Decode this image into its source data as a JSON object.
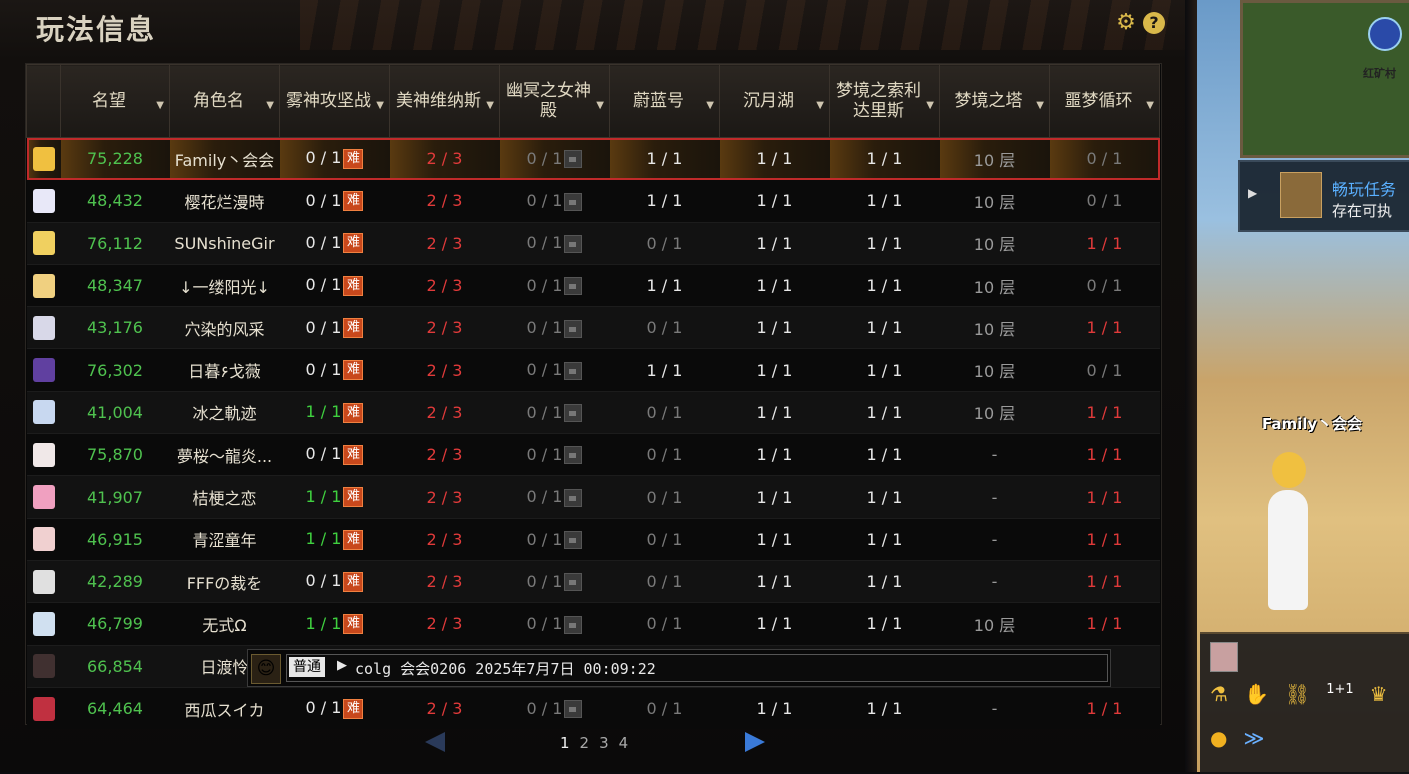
{
  "panel": {
    "title": "玩法信息"
  },
  "columns": [
    {
      "label": ""
    },
    {
      "label": "名望"
    },
    {
      "label": "角色名"
    },
    {
      "label": "雾神攻坚战"
    },
    {
      "label": "美神维纳斯"
    },
    {
      "label": "幽冥之女神殿"
    },
    {
      "label": "蔚蓝号"
    },
    {
      "label": "沉月湖"
    },
    {
      "label": "梦境之索利达里斯"
    },
    {
      "label": "梦境之塔"
    },
    {
      "label": "噩梦循环"
    }
  ],
  "rows": [
    {
      "fame": "75,228",
      "name": "Family丶会会",
      "c1": "0 / 1",
      "c1tag": "hard",
      "c2": "2 / 3",
      "c3": "0 / 1",
      "c4": "1 / 1",
      "c5": "1 / 1",
      "c6": "1 / 1",
      "c7": "10 层",
      "c8": "0 / 1"
    },
    {
      "fame": "48,432",
      "name": "樱花烂漫時",
      "c1": "0 / 1",
      "c1tag": "hard",
      "c2": "2 / 3",
      "c3": "0 / 1",
      "c4": "1 / 1",
      "c5": "1 / 1",
      "c6": "1 / 1",
      "c7": "10 层",
      "c8": "0 / 1"
    },
    {
      "fame": "76,112",
      "name": "SUNshīneGir",
      "c1": "0 / 1",
      "c1tag": "hard",
      "c2": "2 / 3",
      "c3": "0 / 1",
      "c4": "0 / 1",
      "c5": "1 / 1",
      "c6": "1 / 1",
      "c7": "10 层",
      "c8": "1 / 1"
    },
    {
      "fame": "48,347",
      "name": "↓一缕阳光↓",
      "c1": "0 / 1",
      "c1tag": "hard",
      "c2": "2 / 3",
      "c3": "0 / 1",
      "c4": "1 / 1",
      "c5": "1 / 1",
      "c6": "1 / 1",
      "c7": "10 层",
      "c8": "0 / 1"
    },
    {
      "fame": "43,176",
      "name": "穴染的风采",
      "c1": "0 / 1",
      "c1tag": "hard",
      "c2": "2 / 3",
      "c3": "0 / 1",
      "c4": "0 / 1",
      "c5": "1 / 1",
      "c6": "1 / 1",
      "c7": "10 层",
      "c8": "1 / 1"
    },
    {
      "fame": "76,302",
      "name": "日暮۶戈薇",
      "c1": "0 / 1",
      "c1tag": "hard",
      "c2": "2 / 3",
      "c3": "0 / 1",
      "c4": "1 / 1",
      "c5": "1 / 1",
      "c6": "1 / 1",
      "c7": "10 层",
      "c8": "0 / 1"
    },
    {
      "fame": "41,004",
      "name": "冰之軌迹",
      "c1": "1 / 1",
      "c1tag": "hard",
      "c2": "2 / 3",
      "c3": "0 / 1",
      "c4": "0 / 1",
      "c5": "1 / 1",
      "c6": "1 / 1",
      "c7": "10 层",
      "c8": "1 / 1"
    },
    {
      "fame": "75,870",
      "name": "夢桜～龍炎...",
      "c1": "0 / 1",
      "c1tag": "hard",
      "c2": "2 / 3",
      "c3": "0 / 1",
      "c4": "0 / 1",
      "c5": "1 / 1",
      "c6": "1 / 1",
      "c7": "-",
      "c8": "1 / 1"
    },
    {
      "fame": "41,907",
      "name": "桔梗之恋",
      "c1": "1 / 1",
      "c1tag": "hard",
      "c2": "2 / 3",
      "c3": "0 / 1",
      "c4": "0 / 1",
      "c5": "1 / 1",
      "c6": "1 / 1",
      "c7": "-",
      "c8": "1 / 1"
    },
    {
      "fame": "46,915",
      "name": "青涩童年",
      "c1": "1 / 1",
      "c1tag": "hard",
      "c2": "2 / 3",
      "c3": "0 / 1",
      "c4": "0 / 1",
      "c5": "1 / 1",
      "c6": "1 / 1",
      "c7": "-",
      "c8": "1 / 1"
    },
    {
      "fame": "42,289",
      "name": "FFFの裁を",
      "c1": "0 / 1",
      "c1tag": "hard",
      "c2": "2 / 3",
      "c3": "0 / 1",
      "c4": "0 / 1",
      "c5": "1 / 1",
      "c6": "1 / 1",
      "c7": "-",
      "c8": "1 / 1"
    },
    {
      "fame": "46,799",
      "name": "无式Ω",
      "c1": "1 / 1",
      "c1tag": "hard",
      "c2": "2 / 3",
      "c3": "0 / 1",
      "c4": "0 / 1",
      "c5": "1 / 1",
      "c6": "1 / 1",
      "c7": "10 层",
      "c8": "1 / 1"
    },
    {
      "fame": "66,854",
      "name": "日渡怜",
      "c1": "",
      "c1tag": "",
      "c2": "",
      "c3": "",
      "c4": "",
      "c5": "",
      "c6": "",
      "c7": "",
      "c8": "1"
    },
    {
      "fame": "64,464",
      "name": "西瓜スイカ",
      "c1": "0 / 1",
      "c1tag": "hard",
      "c2": "2 / 3",
      "c3": "0 / 1",
      "c4": "0 / 1",
      "c5": "1 / 1",
      "c6": "1 / 1",
      "c7": "-",
      "c8": "1 / 1"
    }
  ],
  "hard_label": "难",
  "chat": {
    "channel": "普通",
    "text": "colg 会会0206 2025年7月7日 00:09:22"
  },
  "pager": {
    "pages": [
      "1",
      "2",
      "3",
      "4"
    ],
    "current": "1"
  },
  "game": {
    "minimap_label": "红矿村",
    "quest_title": "畅玩任务",
    "quest_sub": "存在可执",
    "character_name": "Family丶会会",
    "badge_text": "1+1"
  }
}
